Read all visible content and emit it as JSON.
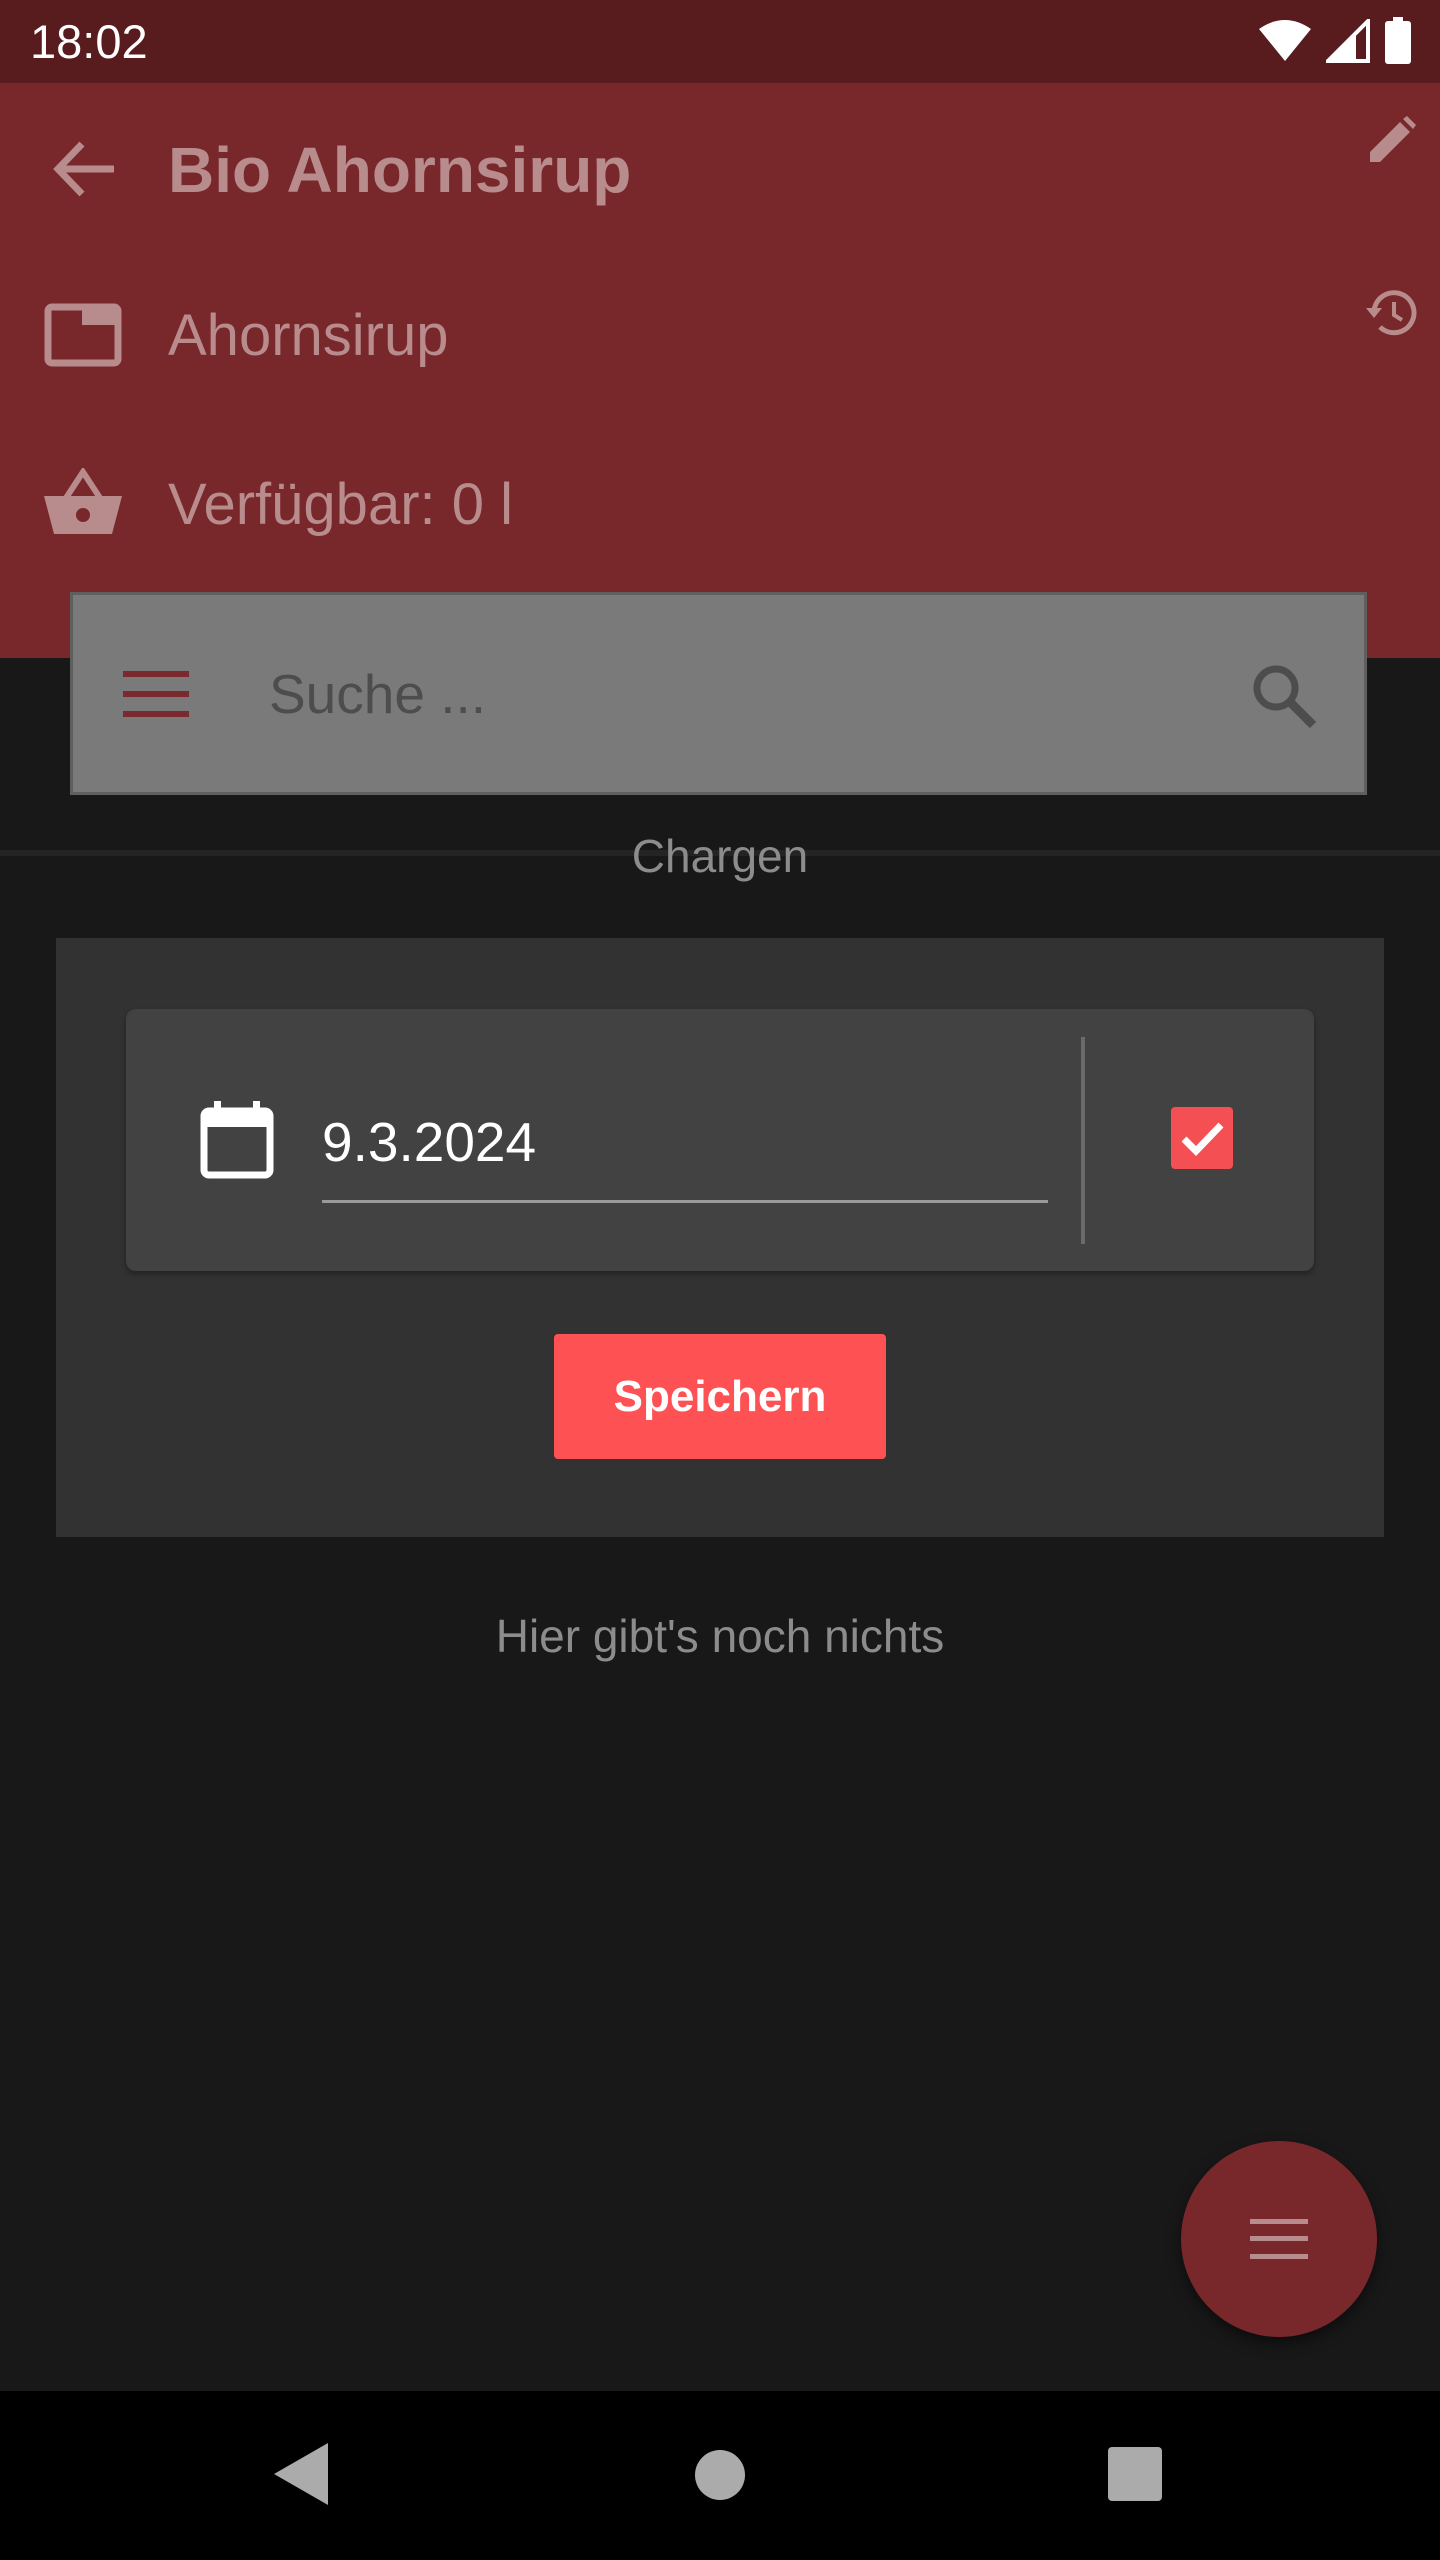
{
  "status_bar": {
    "time": "18:02",
    "icons": [
      "wifi-icon",
      "signal-icon",
      "battery-icon"
    ]
  },
  "app_bar": {
    "title": "Bio Ahornsirup",
    "category": "Ahornsirup",
    "available": "Verfügbar: 0 l",
    "icons": [
      "back-arrow-icon",
      "edit-pencil-icon",
      "history-icon",
      "folder-icon",
      "basket-icon"
    ]
  },
  "search": {
    "placeholder": "Suche ..."
  },
  "tab": {
    "label": "Chargen"
  },
  "form": {
    "date_value": "9.3.2024",
    "checkbox_checked": true,
    "save_label": "Speichern"
  },
  "empty_state": "Hier gibt's noch nichts",
  "colors": {
    "status_bar": "#581c1e",
    "app_bar": "#78272b",
    "accent": "#fd5153",
    "background": "#181818",
    "card": "#323232"
  }
}
